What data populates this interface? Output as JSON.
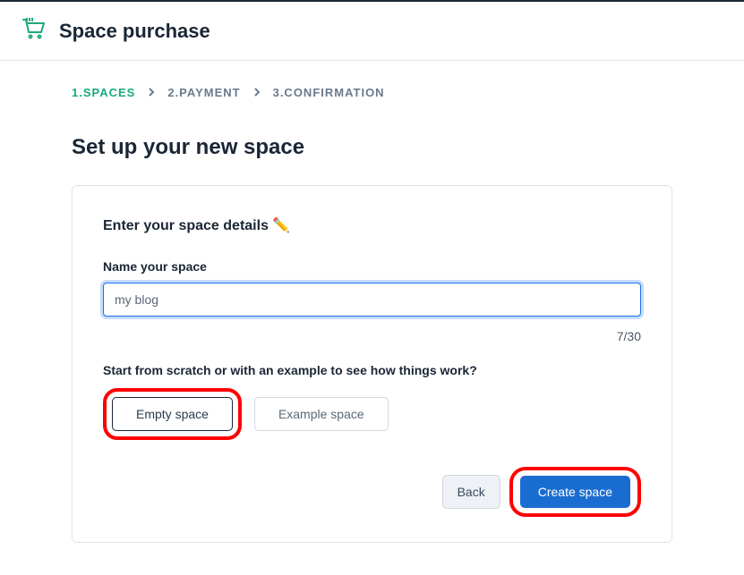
{
  "header": {
    "title": "Space purchase"
  },
  "breadcrumb": {
    "step1": "1.SPACES",
    "step2": "2.PAYMENT",
    "step3": "3.CONFIRMATION"
  },
  "main": {
    "heading": "Set up your new space"
  },
  "card": {
    "title": "Enter your space details ✏️",
    "name_label": "Name your space",
    "name_value": "my blog",
    "char_count": "7/30",
    "prompt_label": "Start from scratch or with an example to see how things work?",
    "option_empty": "Empty space",
    "option_example": "Example space"
  },
  "actions": {
    "back": "Back",
    "create": "Create space"
  }
}
